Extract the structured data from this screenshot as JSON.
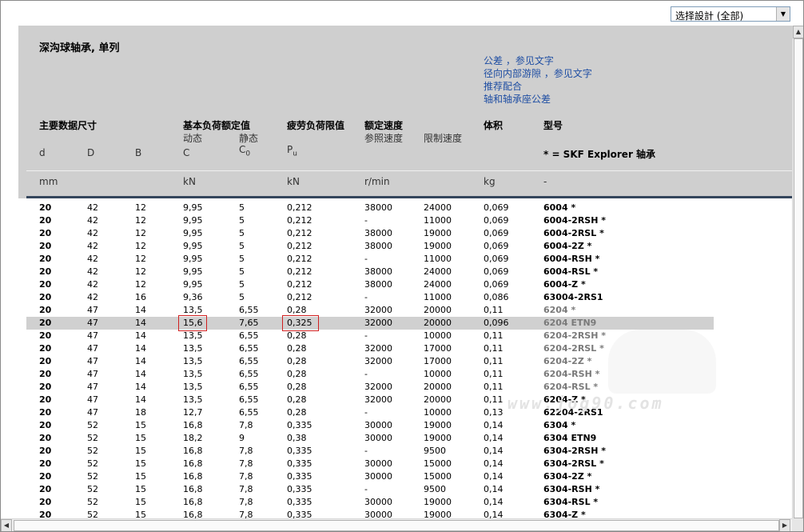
{
  "design_select": {
    "value": "选择設計 (全部)"
  },
  "title": "深沟球轴承, 单列",
  "links": [
    "公差 ，参见文字",
    "径向内部游隙 ，参见文字",
    "推荐配合",
    "轴和轴承座公差"
  ],
  "headers": {
    "main_dims": "主要数据尺寸",
    "load_rating": "基本负荷额定值",
    "dynamic": "动态",
    "static": "静态",
    "fatigue": "疲劳负荷限值",
    "speed": "额定速度",
    "ref_speed": "参照速度",
    "limit_speed": "限制速度",
    "mass": "体积",
    "designation": "型号",
    "d": "d",
    "D": "D",
    "B": "B",
    "C": "C",
    "C0": "C",
    "C0_sub": "0",
    "Pu": "P",
    "Pu_sub": "u",
    "skf_note": "* = SKF Explorer 轴承",
    "unit_mm": "mm",
    "unit_kN1": "kN",
    "unit_kN2": "kN",
    "unit_rmin": "r/min",
    "unit_kg": "kg",
    "unit_dash": "-"
  },
  "rows": [
    [
      "20",
      "42",
      "12",
      "9,95",
      "5",
      "0,212",
      "38000",
      "24000",
      "0,069",
      "6004 *"
    ],
    [
      "20",
      "42",
      "12",
      "9,95",
      "5",
      "0,212",
      "-",
      "11000",
      "0,069",
      "6004-2RSH *"
    ],
    [
      "20",
      "42",
      "12",
      "9,95",
      "5",
      "0,212",
      "38000",
      "19000",
      "0,069",
      "6004-2RSL *"
    ],
    [
      "20",
      "42",
      "12",
      "9,95",
      "5",
      "0,212",
      "38000",
      "19000",
      "0,069",
      "6004-2Z *"
    ],
    [
      "20",
      "42",
      "12",
      "9,95",
      "5",
      "0,212",
      "-",
      "11000",
      "0,069",
      "6004-RSH *"
    ],
    [
      "20",
      "42",
      "12",
      "9,95",
      "5",
      "0,212",
      "38000",
      "24000",
      "0,069",
      "6004-RSL *"
    ],
    [
      "20",
      "42",
      "12",
      "9,95",
      "5",
      "0,212",
      "38000",
      "24000",
      "0,069",
      "6004-Z *"
    ],
    [
      "20",
      "42",
      "16",
      "9,36",
      "5",
      "0,212",
      "-",
      "11000",
      "0,086",
      "63004-2RS1"
    ],
    [
      "20",
      "47",
      "14",
      "13,5",
      "6,55",
      "0,28",
      "32000",
      "20000",
      "0,11",
      "6204 *"
    ],
    [
      "20",
      "47",
      "14",
      "15,6",
      "7,65",
      "0,325",
      "32000",
      "20000",
      "0,096",
      "6204 ETN9"
    ],
    [
      "20",
      "47",
      "14",
      "13,5",
      "6,55",
      "0,28",
      "-",
      "10000",
      "0,11",
      "6204-2RSH *"
    ],
    [
      "20",
      "47",
      "14",
      "13,5",
      "6,55",
      "0,28",
      "32000",
      "17000",
      "0,11",
      "6204-2RSL *"
    ],
    [
      "20",
      "47",
      "14",
      "13,5",
      "6,55",
      "0,28",
      "32000",
      "17000",
      "0,11",
      "6204-2Z *"
    ],
    [
      "20",
      "47",
      "14",
      "13,5",
      "6,55",
      "0,28",
      "-",
      "10000",
      "0,11",
      "6204-RSH *"
    ],
    [
      "20",
      "47",
      "14",
      "13,5",
      "6,55",
      "0,28",
      "32000",
      "20000",
      "0,11",
      "6204-RSL *"
    ],
    [
      "20",
      "47",
      "14",
      "13,5",
      "6,55",
      "0,28",
      "32000",
      "20000",
      "0,11",
      "6204-Z *"
    ],
    [
      "20",
      "47",
      "18",
      "12,7",
      "6,55",
      "0,28",
      "-",
      "10000",
      "0,13",
      "62204-2RS1"
    ],
    [
      "20",
      "52",
      "15",
      "16,8",
      "7,8",
      "0,335",
      "30000",
      "19000",
      "0,14",
      "6304 *"
    ],
    [
      "20",
      "52",
      "15",
      "18,2",
      "9",
      "0,38",
      "30000",
      "19000",
      "0,14",
      "6304 ETN9"
    ],
    [
      "20",
      "52",
      "15",
      "16,8",
      "7,8",
      "0,335",
      "-",
      "9500",
      "0,14",
      "6304-2RSH *"
    ],
    [
      "20",
      "52",
      "15",
      "16,8",
      "7,8",
      "0,335",
      "30000",
      "15000",
      "0,14",
      "6304-2RSL *"
    ],
    [
      "20",
      "52",
      "15",
      "16,8",
      "7,8",
      "0,335",
      "30000",
      "15000",
      "0,14",
      "6304-2Z *"
    ],
    [
      "20",
      "52",
      "15",
      "16,8",
      "7,8",
      "0,335",
      "-",
      "9500",
      "0,14",
      "6304-RSH *"
    ],
    [
      "20",
      "52",
      "15",
      "16,8",
      "7,8",
      "0,335",
      "30000",
      "19000",
      "0,14",
      "6304-RSL *"
    ],
    [
      "20",
      "52",
      "15",
      "16,8",
      "7,8",
      "0,335",
      "30000",
      "19000",
      "0,14",
      "6304-Z *"
    ]
  ],
  "highlight_row": 9,
  "watermark": "www.jog90.com"
}
